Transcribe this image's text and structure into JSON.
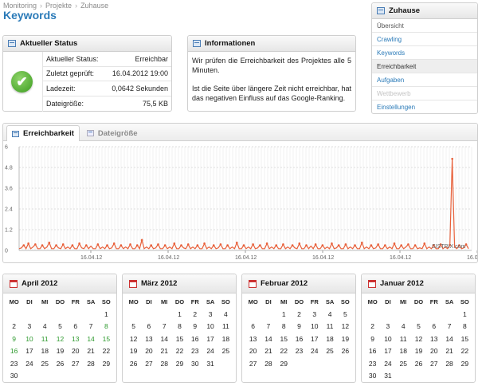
{
  "breadcrumb": [
    "Monitoring",
    "Projekte",
    "Zuhause"
  ],
  "page_title": "Keywords",
  "status": {
    "header": "Aktueller Status",
    "rows": [
      {
        "label": "Aktueller Status:",
        "value": "Erreichbar"
      },
      {
        "label": "Zuletzt geprüft:",
        "value": "16.04.2012 19:00"
      },
      {
        "label": "Ladezeit:",
        "value": "0,0642 Sekunden"
      },
      {
        "label": "Dateigröße:",
        "value": "75,5 KB"
      }
    ],
    "icon": "check-circle-icon",
    "icon_color": "#3a9c1e"
  },
  "info": {
    "header": "Informationen",
    "paragraphs": [
      "Wir prüfen die Erreichbarkeit des Projektes alle 5 Minuten.",
      "Ist die Seite über längere Zeit nicht erreichbar, hat das negativen Einfluss auf das Google-Ranking."
    ]
  },
  "nav": {
    "header": "Zuhause",
    "items": [
      {
        "label": "Übersicht",
        "state": "plain"
      },
      {
        "label": "Crawling",
        "state": "link"
      },
      {
        "label": "Keywords",
        "state": "link"
      },
      {
        "label": "Erreichbarkeit",
        "state": "active"
      },
      {
        "label": "Aufgaben",
        "state": "link"
      },
      {
        "label": "Wettbewerb",
        "state": "disabled"
      },
      {
        "label": "Einstellungen",
        "state": "link"
      }
    ]
  },
  "tabs": [
    {
      "label": "Erreichbarkeit",
      "active": true
    },
    {
      "label": "Dateigröße",
      "active": false
    }
  ],
  "chart_data": {
    "type": "line",
    "ylim": [
      0,
      6
    ],
    "yticks": [
      "0",
      "1.2",
      "2.4",
      "3.6",
      "4.8",
      "6"
    ],
    "xticks": [
      "16.04.12",
      "16.04.12",
      "16.04.12",
      "16.04.12",
      "16.04.12",
      "16.04.12"
    ],
    "grid": true,
    "line_color": "#e8603a",
    "watermark": "SISTRIX.com",
    "spike_value": 5.3,
    "baseline_value": 0.1,
    "series": [
      {
        "values": [
          0.1,
          0.15,
          0.3,
          0.1,
          0.4,
          0.1,
          0.2,
          0.35,
          0.1,
          0.1,
          0.3,
          0.1,
          0.2,
          0.45,
          0.1,
          0.1,
          0.3,
          0.15,
          0.1,
          0.35,
          0.1,
          0.2,
          0.1,
          0.3,
          0.1,
          0.1,
          0.4,
          0.15,
          0.1,
          0.3,
          0.1,
          0.25,
          0.1,
          0.1,
          0.35,
          0.1,
          0.2,
          0.1,
          0.3,
          0.1,
          0.15,
          0.4,
          0.1,
          0.1,
          0.3,
          0.1,
          0.2,
          0.1,
          0.35,
          0.1,
          0.1,
          0.3,
          0.1,
          0.6,
          0.1,
          0.2,
          0.1,
          0.3,
          0.1,
          0.15,
          0.35,
          0.1,
          0.1,
          0.3,
          0.1,
          0.2,
          0.1,
          0.4,
          0.1,
          0.1,
          0.3,
          0.15,
          0.1,
          0.35,
          0.1,
          0.2,
          0.1,
          0.3,
          0.1,
          0.1,
          0.4,
          0.1,
          0.2,
          0.1,
          0.3,
          0.1,
          0.15,
          0.35,
          0.1,
          0.1,
          0.3,
          0.1,
          0.2,
          0.1,
          0.45,
          0.1,
          0.1,
          0.3,
          0.1,
          0.2,
          0.1,
          0.35,
          0.1,
          0.15,
          0.3,
          0.1,
          0.1,
          0.4,
          0.1,
          0.2,
          0.1,
          0.3,
          0.1,
          0.1,
          0.35,
          0.1,
          0.2,
          0.1,
          0.3,
          0.15,
          0.1,
          0.4,
          0.1,
          0.1,
          0.3,
          0.1,
          0.25,
          0.1,
          0.35,
          0.1,
          0.1,
          0.3,
          0.1,
          0.2,
          0.1,
          0.4,
          0.1,
          0.15,
          0.3,
          0.1,
          0.1,
          0.35,
          0.1,
          0.2,
          0.1,
          0.3,
          0.1,
          0.1,
          0.45,
          0.1,
          0.2,
          0.1,
          0.3,
          0.1,
          0.15,
          0.35,
          0.1,
          0.1,
          0.3,
          0.1,
          0.2,
          0.1,
          0.4,
          0.1,
          0.1,
          0.3,
          0.1,
          0.2,
          0.35,
          0.1,
          0.1,
          0.3,
          0.1,
          0.15,
          0.1,
          0.4,
          0.1,
          0.2,
          0.1,
          0.3,
          0.1,
          0.1,
          0.35,
          0.1,
          0.2,
          0.1,
          0.3,
          5.3,
          0.2,
          0.1,
          0.3,
          0.1,
          0.15,
          0.35,
          0.1
        ]
      }
    ]
  },
  "calendars": [
    {
      "title": "April 2012",
      "lead": 6,
      "days": 30,
      "green": [
        8,
        9,
        10,
        11,
        12,
        13,
        14,
        15,
        16
      ]
    },
    {
      "title": "März 2012",
      "lead": 3,
      "days": 31,
      "green": []
    },
    {
      "title": "Februar 2012",
      "lead": 2,
      "days": 29,
      "green": []
    },
    {
      "title": "Januar 2012",
      "lead": 6,
      "days": 31,
      "green": []
    }
  ],
  "weekdays": [
    "MO",
    "DI",
    "MI",
    "DO",
    "FR",
    "SA",
    "SO"
  ]
}
